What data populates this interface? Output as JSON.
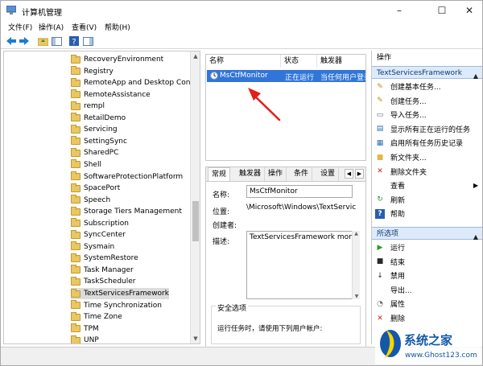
{
  "window": {
    "title": "计算机管理"
  },
  "menu": [
    "文件(F)",
    "操作(A)",
    "查看(V)",
    "帮助(H)"
  ],
  "tree": {
    "items": [
      "RecoveryEnvironment",
      "Registry",
      "RemoteApp and Desktop Conn",
      "RemoteAssistance",
      "rempl",
      "RetailDemo",
      "Servicing",
      "SettingSync",
      "SharedPC",
      "Shell",
      "SoftwareProtectionPlatform",
      "SpacePort",
      "Speech",
      "Storage Tiers Management",
      "Subscription",
      "SyncCenter",
      "Sysmain",
      "SystemRestore",
      "Task Manager",
      "TaskScheduler",
      "TextServicesFramework",
      "Time Synchronization",
      "Time Zone",
      "TPM",
      "UNP"
    ],
    "selected_index": 20
  },
  "tasks": {
    "columns": [
      "名称",
      "状态",
      "触发器"
    ],
    "rows": [
      {
        "name": "MsCtfMonitor",
        "status": "正在运行",
        "trigger": "当任何用户登录"
      }
    ]
  },
  "details": {
    "tabs": [
      "常规",
      "触发器",
      "操作",
      "条件",
      "设置"
    ],
    "name_label": "名称:",
    "name_value": "MsCtfMonitor",
    "location_label": "位置:",
    "location_value": "\\Microsoft\\Windows\\TextServic",
    "author_label": "创建者:",
    "description_label": "描述:",
    "description_value": "TextServicesFramework monito",
    "security_title": "安全选项",
    "security_text": "运行任务时，请使用下列用户帐户:"
  },
  "actions": {
    "header": "操作",
    "section1": "TextServicesFramework",
    "items1": [
      {
        "label": "创建基本任务...",
        "icon": "create-basic-task-icon"
      },
      {
        "label": "创建任务...",
        "icon": "create-task-icon"
      },
      {
        "label": "导入任务...",
        "icon": "import-task-icon"
      },
      {
        "label": "显示所有正在运行的任务",
        "icon": "show-running-icon"
      },
      {
        "label": "启用所有任务历史记录",
        "icon": "history-icon"
      },
      {
        "label": "新文件夹...",
        "icon": "new-folder-icon"
      },
      {
        "label": "删除文件夹",
        "icon": "delete-folder-icon"
      },
      {
        "label": "查看",
        "icon": "view-icon"
      },
      {
        "label": "刷新",
        "icon": "refresh-icon"
      },
      {
        "label": "帮助",
        "icon": "help-icon"
      }
    ],
    "section2": "所选项",
    "items2": [
      {
        "label": "运行",
        "icon": "run-icon"
      },
      {
        "label": "结束",
        "icon": "end-icon"
      },
      {
        "label": "禁用",
        "icon": "disable-icon"
      },
      {
        "label": "导出...",
        "icon": "export-icon"
      },
      {
        "label": "属性",
        "icon": "properties-icon"
      },
      {
        "label": "删除",
        "icon": "delete-icon"
      }
    ]
  },
  "watermark": {
    "brand": "系统之家",
    "url": "www.Ghost123.com"
  },
  "colors": {
    "selection": "#3175d8",
    "arrow": "#e0201b",
    "section_bg": "#ddeaf9"
  }
}
